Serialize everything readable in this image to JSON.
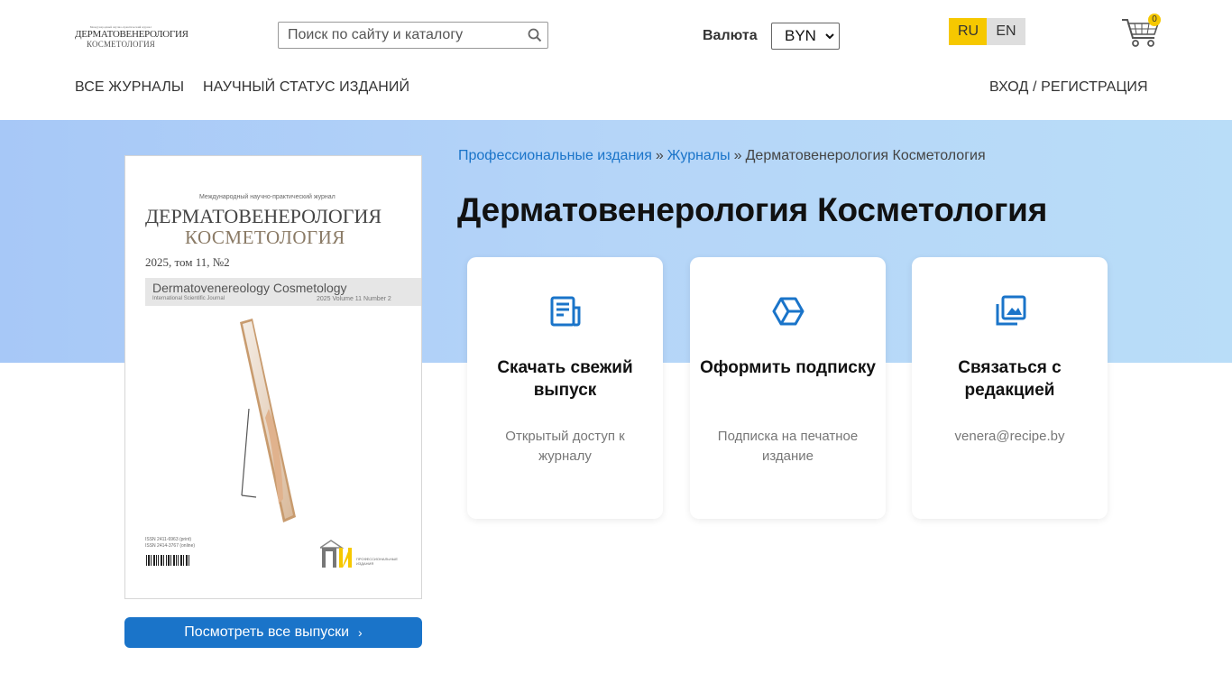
{
  "header": {
    "logo": {
      "line1": "Международный научно-практический журнал",
      "line2": "ДЕРМАТОВЕНЕРОЛОГИЯ",
      "line3": "КОСМЕТОЛОГИЯ"
    },
    "search_placeholder": "Поиск по сайту и каталогу",
    "search_icon": "search-icon",
    "currency_label": "Валюта",
    "currency_value": "BYN",
    "lang_ru": "RU",
    "lang_en": "EN",
    "cart_count": "0",
    "cart_icon": "cart-icon",
    "accent_color": "#f6c800"
  },
  "nav": {
    "all_journals": "ВСЕ ЖУРНАЛЫ",
    "scientific_status": "НАУЧНЫЙ СТАТУС ИЗДАНИЙ",
    "login": "ВХОД / РЕГИСТРАЦИЯ"
  },
  "cover": {
    "subtitle_top": "Международный научно-практический журнал",
    "title_line1": "ДЕРМАТОВЕНЕРОЛОГИЯ",
    "title_line2": "КОСМЕТОЛОГИЯ",
    "issue": "2025, том 11, №2",
    "en_title": "Dermatovenereology  Cosmetology",
    "en_sub": "International Scientific Journal",
    "en_issue": "2025   Volume 11   Number 2",
    "issn1": "ISSN 2411-6963 (print)",
    "issn2": "ISSN 2414-3767 (online)",
    "publisher_label": "ПРОФЕССИОНАЛЬНЫЕ ИЗДАНИЯ"
  },
  "buttons": {
    "all_issues": "Посмотреть все выпуски",
    "all_issues_chevron": "›",
    "button_color": "#1a74c9"
  },
  "breadcrumb": {
    "item1": "Профессиональные издания",
    "item2": "Журналы",
    "item3": "Дерматовенерология Косметология",
    "separator": "»"
  },
  "page_title": "Дерматовенерология Косметология",
  "cards": [
    {
      "icon": "newspaper-icon",
      "title": "Скачать свежий выпуск",
      "desc": "Открытый доступ к журналу"
    },
    {
      "icon": "box-icon",
      "title": "Оформить подписку",
      "desc": "Подписка на печатное издание"
    },
    {
      "icon": "gallery-icon",
      "title": "Связаться с редакцией",
      "desc": "venera@recipe.by"
    }
  ]
}
